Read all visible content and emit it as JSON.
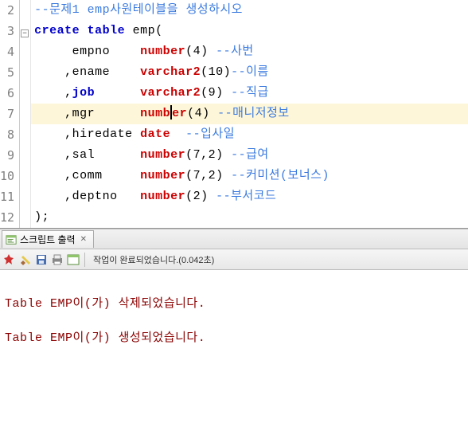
{
  "editor": {
    "lines": [
      {
        "num": 2,
        "tokens": [
          [
            "comment",
            "--문제1 emp사원테이블을 생성하시오"
          ]
        ]
      },
      {
        "num": 3,
        "fold": true,
        "tokens": [
          [
            "kw",
            "create"
          ],
          [
            "ident",
            " "
          ],
          [
            "kw",
            "table"
          ],
          [
            "ident",
            " emp("
          ]
        ]
      },
      {
        "num": 4,
        "tokens": [
          [
            "ident",
            "     empno    "
          ],
          [
            "dtype",
            "number"
          ],
          [
            "punct",
            "(4) "
          ],
          [
            "comment",
            "--사번"
          ]
        ]
      },
      {
        "num": 5,
        "tokens": [
          [
            "ident",
            "    ,ename    "
          ],
          [
            "dtype",
            "varchar2"
          ],
          [
            "punct",
            "(10)"
          ],
          [
            "comment",
            "--이름"
          ]
        ]
      },
      {
        "num": 6,
        "tokens": [
          [
            "ident",
            "    ,"
          ],
          [
            "kw",
            "job"
          ],
          [
            "ident",
            "      "
          ],
          [
            "dtype",
            "varchar2"
          ],
          [
            "punct",
            "(9) "
          ],
          [
            "comment",
            "--직급"
          ]
        ]
      },
      {
        "num": 7,
        "hl": true,
        "cursorAfter": 3,
        "tokens": [
          [
            "ident",
            "    ,mgr      "
          ],
          [
            "dtype",
            "numb"
          ],
          [
            "CURSOR",
            ""
          ],
          [
            "dtype",
            "er"
          ],
          [
            "punct",
            "(4) "
          ],
          [
            "comment",
            "--매니저정보"
          ]
        ]
      },
      {
        "num": 8,
        "tokens": [
          [
            "ident",
            "    ,hiredate "
          ],
          [
            "dtype",
            "date"
          ],
          [
            "ident",
            "  "
          ],
          [
            "comment",
            "--입사일"
          ]
        ]
      },
      {
        "num": 9,
        "tokens": [
          [
            "ident",
            "    ,sal      "
          ],
          [
            "dtype",
            "number"
          ],
          [
            "punct",
            "(7,2) "
          ],
          [
            "comment",
            "--급여"
          ]
        ]
      },
      {
        "num": 10,
        "tokens": [
          [
            "ident",
            "    ,comm     "
          ],
          [
            "dtype",
            "number"
          ],
          [
            "punct",
            "(7,2) "
          ],
          [
            "comment",
            "--커미션(보너스)"
          ]
        ]
      },
      {
        "num": 11,
        "tokens": [
          [
            "ident",
            "    ,deptno   "
          ],
          [
            "dtype",
            "number"
          ],
          [
            "punct",
            "(2) "
          ],
          [
            "comment",
            "--부서코드"
          ]
        ]
      },
      {
        "num": 12,
        "tokens": [
          [
            "ident",
            ");"
          ]
        ]
      }
    ]
  },
  "panel": {
    "tab_label": "스크립트 출력",
    "status": "작업이 완료되었습니다.(0.042초)"
  },
  "output": {
    "line1": "Table EMP이(가) 삭제되었습니다.",
    "line2": "Table EMP이(가) 생성되었습니다."
  }
}
